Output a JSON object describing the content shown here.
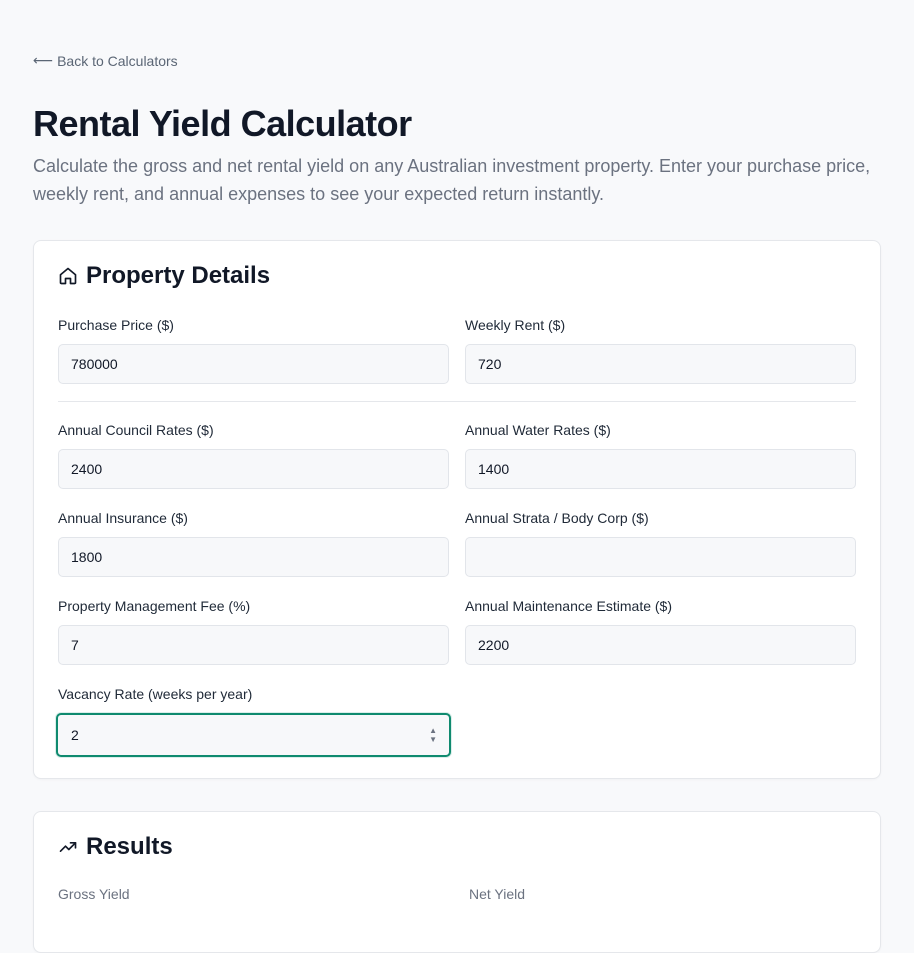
{
  "nav": {
    "back_label": "Back to Calculators",
    "back_arrow": "⟵"
  },
  "header": {
    "title": "Rental Yield Calculator",
    "description": "Calculate the gross and net rental yield on any Australian investment property. Enter your purchase price, weekly rent, and annual expenses to see your expected return instantly."
  },
  "details": {
    "title": "Property Details",
    "icon": "home-icon",
    "fields": {
      "purchase_price": {
        "label": "Purchase Price ($)",
        "value": "780000"
      },
      "weekly_rent": {
        "label": "Weekly Rent ($)",
        "value": "720"
      },
      "council_rates": {
        "label": "Annual Council Rates ($)",
        "value": "2400"
      },
      "water_rates": {
        "label": "Annual Water Rates ($)",
        "value": "1400"
      },
      "insurance": {
        "label": "Annual Insurance ($)",
        "value": "1800"
      },
      "strata": {
        "label": "Annual Strata / Body Corp ($)",
        "value": ""
      },
      "management_fee": {
        "label": "Property Management Fee (%)",
        "value": "7"
      },
      "maintenance": {
        "label": "Annual Maintenance Estimate ($)",
        "value": "2200"
      },
      "vacancy": {
        "label": "Vacancy Rate (weeks per year)",
        "value": "2"
      }
    }
  },
  "results": {
    "title": "Results",
    "icon": "trending-up-icon",
    "gross_yield": {
      "label": "Gross Yield"
    },
    "net_yield": {
      "label": "Net Yield"
    }
  },
  "colors": {
    "accent": "#0f8a6f",
    "text": "#111827",
    "muted": "#6b7280"
  }
}
